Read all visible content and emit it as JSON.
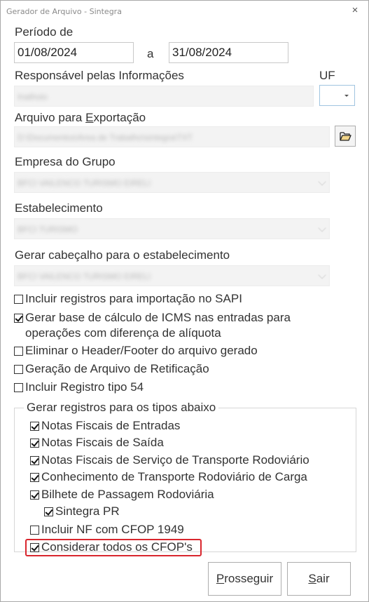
{
  "window": {
    "title": "Gerador de Arquivo - Sintegra",
    "close_glyph": "×"
  },
  "periodo": {
    "label": "Período de",
    "separator": "a",
    "start_value": "01/08/2024",
    "end_value": "31/08/2024"
  },
  "responsavel": {
    "label": "Responsável pelas Informações",
    "value": "Inathoio"
  },
  "uf": {
    "label": "UF",
    "value": ""
  },
  "arquivo": {
    "label_pre": "Arquivo para ",
    "label_accel": "E",
    "label_post": "xportação",
    "value": "D:\\Documentos\\Area de Trabalho\\sintegra\\TXT",
    "browse_icon": "folder-open-icon"
  },
  "empresa": {
    "label": "Empresa do Grupo",
    "value": "BFCI VAILENCO TURISMO EIRELI"
  },
  "estabelecimento": {
    "label": "Estabelecimento",
    "value": "BFCI TURISMO"
  },
  "cabecalho": {
    "label": "Gerar cabeçalho para o estabelecimento",
    "value": "BFCI VAILENCO TURISMO EIRELI"
  },
  "options": [
    {
      "label": "Incluir registros para importação no SAPI",
      "checked": false
    },
    {
      "label_line1": "Gerar base de cálculo de ICMS nas entradas para",
      "label_line2": "operações com diferença de alíquota",
      "checked": true
    },
    {
      "label": "Eliminar o Header/Footer do arquivo gerado",
      "checked": false
    },
    {
      "label": "Geração de Arquivo de Retificação",
      "checked": false
    },
    {
      "label": "Incluir Registro tipo 54",
      "checked": false
    }
  ],
  "group": {
    "legend": "Gerar registros para os tipos abaixo",
    "items": [
      {
        "label": "Notas Fiscais de Entradas",
        "checked": true
      },
      {
        "label": "Notas Fiscais de Saída",
        "checked": true
      },
      {
        "label": "Notas Fiscais de Serviço de Transporte Rodoviário",
        "checked": true
      },
      {
        "label": "Conhecimento de Transporte Rodoviário de Carga",
        "checked": true
      },
      {
        "label": "Bilhete de Passagem Rodoviária",
        "checked": true
      },
      {
        "label": "Sintegra PR",
        "checked": true
      },
      {
        "label": "Incluir NF com CFOP 1949",
        "checked": false
      },
      {
        "label": "Considerar todos os CFOP's",
        "checked": true
      }
    ]
  },
  "buttons": {
    "prosseguir_accel": "P",
    "prosseguir_rest": "rosseguir",
    "sair_accel": "S",
    "sair_rest": "air"
  },
  "colors": {
    "highlight": "#d9262e",
    "border": "#a9a9a9"
  }
}
